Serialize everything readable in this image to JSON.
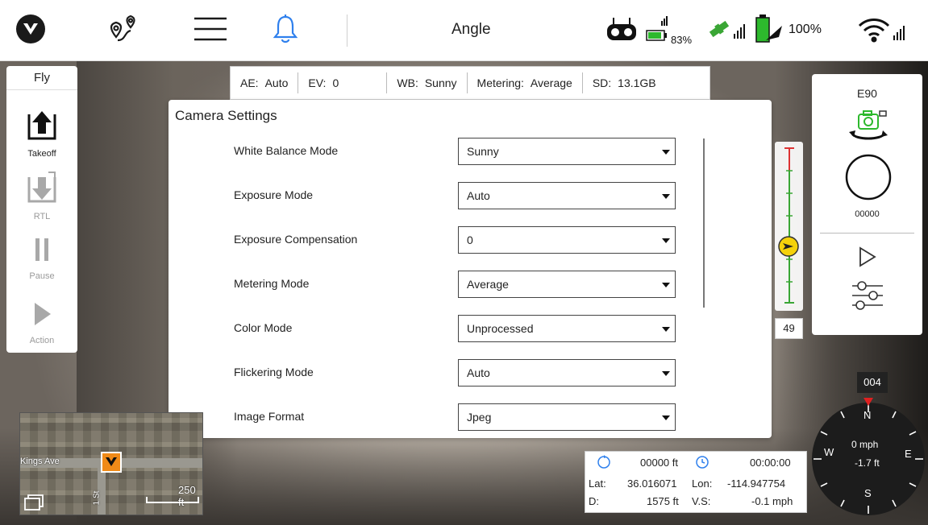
{
  "topbar": {
    "title": "Angle",
    "rc_battery": "83%",
    "drone_battery": "100%"
  },
  "left_panel": {
    "mode": "Fly",
    "takeoff_label": "Takeoff",
    "rtl_label": "RTL",
    "pause_label": "Pause",
    "action_label": "Action"
  },
  "status_strip": [
    {
      "key": "AE:",
      "value": "Auto"
    },
    {
      "key": "EV:",
      "value": "0"
    },
    {
      "key": "WB:",
      "value": "Sunny"
    },
    {
      "key": "Metering:",
      "value": "Average"
    },
    {
      "key": "SD:",
      "value": "13.1GB"
    }
  ],
  "dialog": {
    "title": "Camera Settings",
    "settings": [
      {
        "label": "White Balance Mode",
        "value": "Sunny"
      },
      {
        "label": "Exposure Mode",
        "value": "Auto"
      },
      {
        "label": "Exposure Compensation",
        "value": "0"
      },
      {
        "label": "Metering Mode",
        "value": "Average"
      },
      {
        "label": "Color Mode",
        "value": "Unprocessed"
      },
      {
        "label": "Flickering Mode",
        "value": "Auto"
      },
      {
        "label": "Image Format",
        "value": "Jpeg"
      }
    ]
  },
  "gimbal": {
    "angle": "49"
  },
  "right_panel": {
    "model": "E90",
    "counter": "00000"
  },
  "compass": {
    "heading": "004",
    "north": "N",
    "south": "S",
    "east": "E",
    "west": "W",
    "speed": "0 mph",
    "altitude": "-1.7 ft"
  },
  "telemetry": {
    "distance_home": "00000 ft",
    "flight_time": "00:00:00",
    "lat_label": "Lat:",
    "lat": "36.016071",
    "lon_label": "Lon:",
    "lon": "-114.947754",
    "d_label": "D:",
    "d": "1575 ft",
    "vs_label": "V.S:",
    "vs": "-0.1 mph"
  },
  "minimap": {
    "street": "Kings Ave",
    "street_v": "1 St",
    "scale": "250 ft"
  },
  "colors": {
    "accent_blue": "#2f80ed",
    "battery_green": "#2db92d",
    "gps_green": "#3aa635",
    "gimbal_yellow": "#f5d20b",
    "map_orange": "#f08a18"
  }
}
